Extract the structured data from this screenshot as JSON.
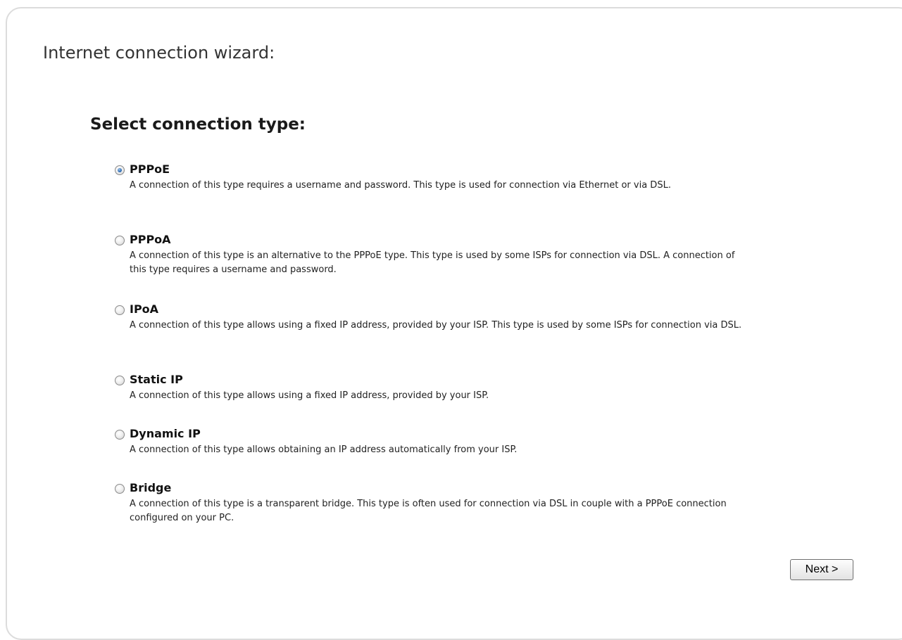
{
  "wizard": {
    "title": "Internet connection wizard:",
    "section_title": "Select connection type:"
  },
  "options": [
    {
      "name": "PPPoE",
      "selected": true,
      "description": "A connection of this type requires a username and password. This type is used for connection via Ethernet or via DSL."
    },
    {
      "name": "PPPoA",
      "selected": false,
      "description": "A connection of this type is an alternative to the PPPoE type. This type is used by some ISPs for connection via DSL. A connection of this type requires a username and password."
    },
    {
      "name": "IPoA",
      "selected": false,
      "description": "A connection of this type allows using a fixed IP address, provided by your ISP. This type is used by some ISPs for connection via DSL."
    },
    {
      "name": "Static IP",
      "selected": false,
      "description": "A connection of this type allows using a fixed IP address, provided by your ISP."
    },
    {
      "name": "Dynamic IP",
      "selected": false,
      "description": "A connection of this type allows obtaining an IP address automatically from your ISP."
    },
    {
      "name": "Bridge",
      "selected": false,
      "description": "A connection of this type is a transparent bridge. This type is often used for connection via DSL in couple with a PPPoE connection configured on your PC."
    }
  ],
  "buttons": {
    "next_label": "Next >"
  },
  "colors": {
    "panel_border": "#dcdcdc",
    "radio_selected": "#2e6db5"
  }
}
